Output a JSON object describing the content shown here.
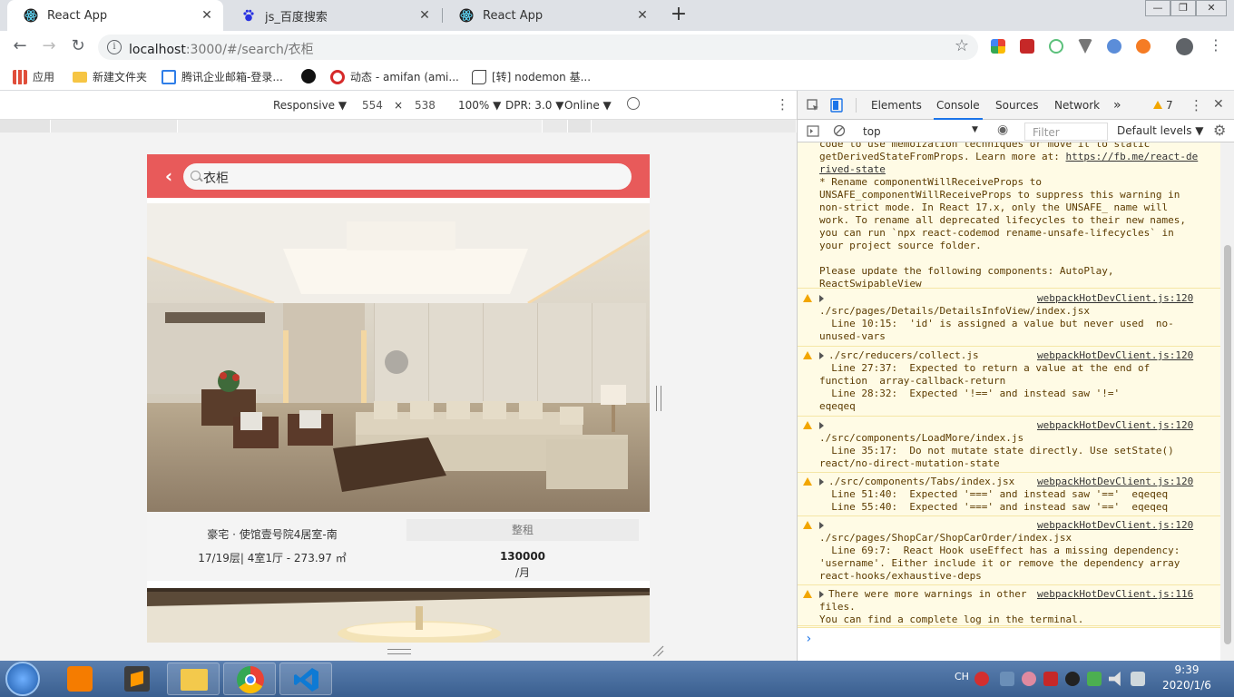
{
  "browser": {
    "tabs": [
      {
        "title": "React App"
      },
      {
        "title": "js_百度搜索"
      },
      {
        "title": "React App"
      }
    ],
    "new_tab_label": "+",
    "url": "localhost:3000/#/search/衣柜",
    "url_host": "localhost",
    "url_rest": ":3000/#/search/衣柜"
  },
  "bookmarks": [
    {
      "label": "应用"
    },
    {
      "label": "新建文件夹"
    },
    {
      "label": "腾讯企业邮箱-登录..."
    },
    {
      "label": ""
    },
    {
      "label": "动态 - amifan (ami..."
    },
    {
      "label": "[转] nodemon 基..."
    }
  ],
  "device_toolbar": {
    "device": "Responsive ▼",
    "width": "554",
    "times": "×",
    "height": "538",
    "zoom": "100% ▼",
    "dpr": "DPR: 3.0 ▼",
    "network": "Online ▼"
  },
  "app": {
    "search_value": "衣柜",
    "house1": {
      "title": "豪宅 · 使馆壹号院4居室-南",
      "detail": "17/19层| 4室1厅 - 273.97 ㎡",
      "tag": "整租",
      "price": "130000",
      "unit": "/月"
    }
  },
  "devtools": {
    "tabs": [
      "Elements",
      "Console",
      "Sources",
      "Network",
      "»"
    ],
    "active_tab": "Console",
    "warning_count": "7",
    "context": "top",
    "filter_placeholder": "Filter",
    "levels": "Default levels ▼",
    "messages": {
      "m0": [
        "code to use memoization techniques or move it to static",
        "getDerivedStateFromProps. Learn more at: ",
        "rived-state",
        "* Rename componentWillReceiveProps to",
        "UNSAFE_componentWillReceiveProps to suppress this warning in",
        "non-strict mode. In React 17.x, only the UNSAFE_ name will",
        "work. To rename all deprecated lifecycles to their new names,",
        "you can run `npx react-codemod rename-unsafe-lifecycles` in",
        "your project source folder.",
        "",
        "Please update the following components: AutoPlay,",
        "ReactSwipableView"
      ],
      "m0_link": "https://fb.me/react-de",
      "m1_src": "webpackHotDevClient.js:120",
      "m1": [
        "./src/pages/Details/DetailsInfoView/index.jsx",
        "  Line 10:15:  'id' is assigned a value but never used  no-",
        "unused-vars"
      ],
      "m2_first": "./src/reducers/collect.js",
      "m2_src": "webpackHotDevClient.js:120",
      "m2": [
        "  Line 27:37:  Expected to return a value at the end of",
        "function  array-callback-return",
        "  Line 28:32:  Expected '!==' and instead saw '!='",
        "eqeqeq"
      ],
      "m3_src": "webpackHotDevClient.js:120",
      "m3": [
        "./src/components/LoadMore/index.js",
        "  Line 35:17:  Do not mutate state directly. Use setState()",
        "react/no-direct-mutation-state"
      ],
      "m4_first": "./src/components/Tabs/index.jsx",
      "m4_src": "webpackHotDevClient.js:120",
      "m4": [
        "  Line 51:40:  Expected '===' and instead saw '=='  eqeqeq",
        "  Line 55:40:  Expected '===' and instead saw '=='  eqeqeq"
      ],
      "m5_src": "webpackHotDevClient.js:120",
      "m5": [
        "./src/pages/ShopCar/ShopCarOrder/index.jsx",
        "  Line 69:7:  React Hook useEffect has a missing dependency:",
        "'username'. Either include it or remove the dependency array",
        "react-hooks/exhaustive-deps"
      ],
      "m6_first": "There were more warnings in other",
      "m6_src": "webpackHotDevClient.js:116",
      "m6": [
        "files.",
        "You can find a complete log in the terminal."
      ]
    },
    "prompt": "›"
  },
  "taskbar": {
    "lang": "CH",
    "time": "9:39",
    "date": "2020/1/6"
  },
  "colors": {
    "header_red": "#e85a5a",
    "console_warn_bg": "#fffbe5",
    "accent": "#1a73e8"
  }
}
